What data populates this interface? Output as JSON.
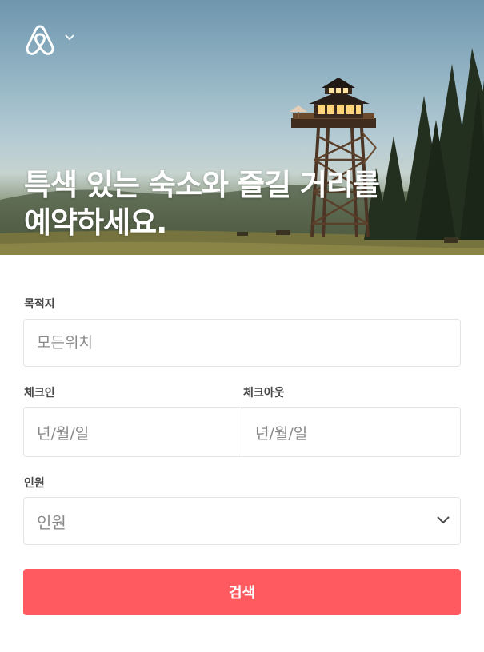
{
  "hero": {
    "headline_line1": "특색 있는 숙소와 즐길 거리를",
    "headline_line2": "예약하세요."
  },
  "form": {
    "destination": {
      "label": "목적지",
      "placeholder": "모든위치"
    },
    "checkin": {
      "label": "체크인",
      "value": "년/월/일"
    },
    "checkout": {
      "label": "체크아웃",
      "value": "년/월/일"
    },
    "guests": {
      "label": "인원",
      "selected": "인원"
    },
    "search_label": "검색"
  },
  "colors": {
    "accent": "#ff5a5f",
    "border": "#e4e4e4",
    "text": "#484848"
  },
  "icons": {
    "logo": "airbnb-logo-icon",
    "caret": "chevron-down-icon",
    "select": "chevron-down-icon"
  }
}
